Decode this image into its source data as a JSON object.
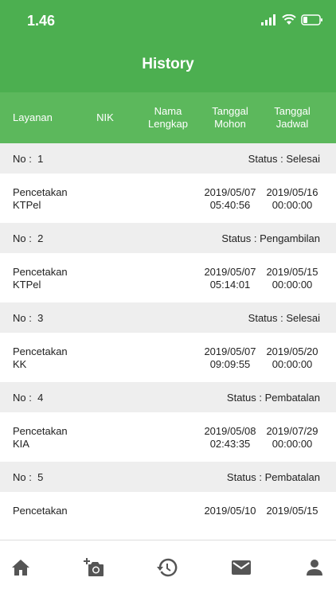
{
  "status_bar": {
    "time": "1.46"
  },
  "app_bar": {
    "title": "History"
  },
  "columns": {
    "layanan": "Layanan",
    "nik": "NIK",
    "nama": "Nama\nLengkap",
    "tanggal_mohon": "Tanggal\nMohon",
    "tanggal_jadwal": "Tanggal\nJadwal"
  },
  "records": [
    {
      "no_label": "No :",
      "no": "1",
      "status": "Status : Selesai",
      "layanan_1": "Pencetakan",
      "layanan_2": "KTPel",
      "mohon_date": "2019/05/07",
      "mohon_time": "05:40:56",
      "jadwal_date": "2019/05/16",
      "jadwal_time": "00:00:00"
    },
    {
      "no_label": "No :",
      "no": "2",
      "status": "Status : Pengambilan",
      "layanan_1": "Pencetakan",
      "layanan_2": "KTPel",
      "mohon_date": "2019/05/07",
      "mohon_time": "05:14:01",
      "jadwal_date": "2019/05/15",
      "jadwal_time": "00:00:00"
    },
    {
      "no_label": "No :",
      "no": "3",
      "status": "Status : Selesai",
      "layanan_1": "Pencetakan",
      "layanan_2": "KK",
      "mohon_date": "2019/05/07",
      "mohon_time": "09:09:55",
      "jadwal_date": "2019/05/20",
      "jadwal_time": "00:00:00"
    },
    {
      "no_label": "No :",
      "no": "4",
      "status": "Status : Pembatalan",
      "layanan_1": "Pencetakan",
      "layanan_2": "KIA",
      "mohon_date": "2019/05/08",
      "mohon_time": "02:43:35",
      "jadwal_date": "2019/07/29",
      "jadwal_time": "00:00:00"
    },
    {
      "no_label": "No :",
      "no": "5",
      "status": "Status : Pembatalan",
      "layanan_1": "Pencetakan",
      "layanan_2": "",
      "mohon_date": "2019/05/10",
      "mohon_time": "",
      "jadwal_date": "2019/05/15",
      "jadwal_time": ""
    }
  ],
  "nav": [
    {
      "icon": "home-icon"
    },
    {
      "icon": "add-photo-icon"
    },
    {
      "icon": "history-icon"
    },
    {
      "icon": "mail-icon"
    },
    {
      "icon": "person-icon"
    }
  ]
}
